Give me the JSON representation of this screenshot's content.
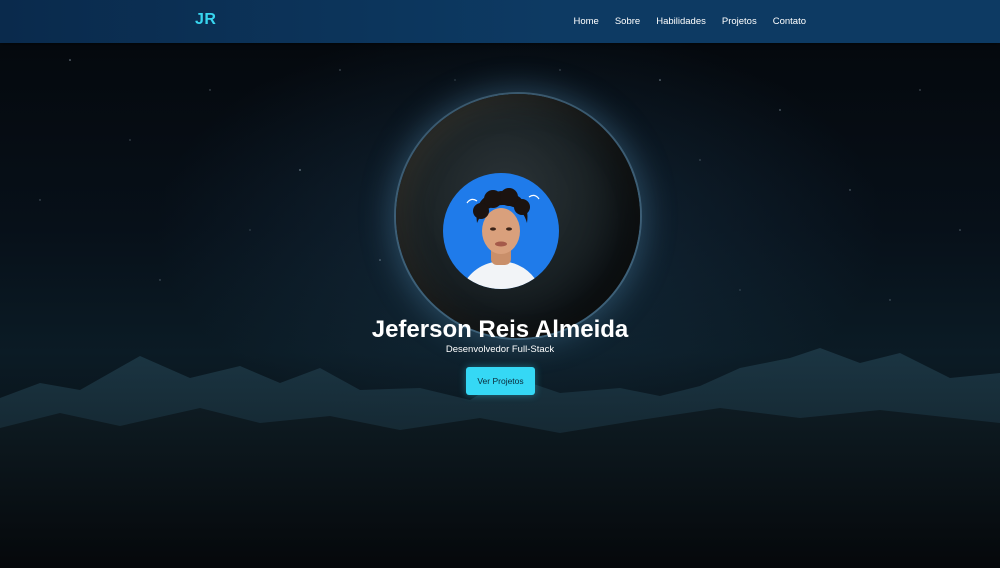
{
  "header": {
    "logo": "JR",
    "nav": [
      {
        "label": "Home"
      },
      {
        "label": "Sobre"
      },
      {
        "label": "Habilidades"
      },
      {
        "label": "Projetos"
      },
      {
        "label": "Contato"
      }
    ]
  },
  "hero": {
    "name": "Jeferson Reis Almeida",
    "role": "Desenvolvedor Full-Stack",
    "cta_label": "Ver Projetos",
    "avatar_icon": "profile-photo"
  },
  "colors": {
    "accent": "#35d8f5",
    "logo": "#38d6f0",
    "nav_bg": "#0d3a63",
    "avatar_bg": "#1f7bea"
  }
}
